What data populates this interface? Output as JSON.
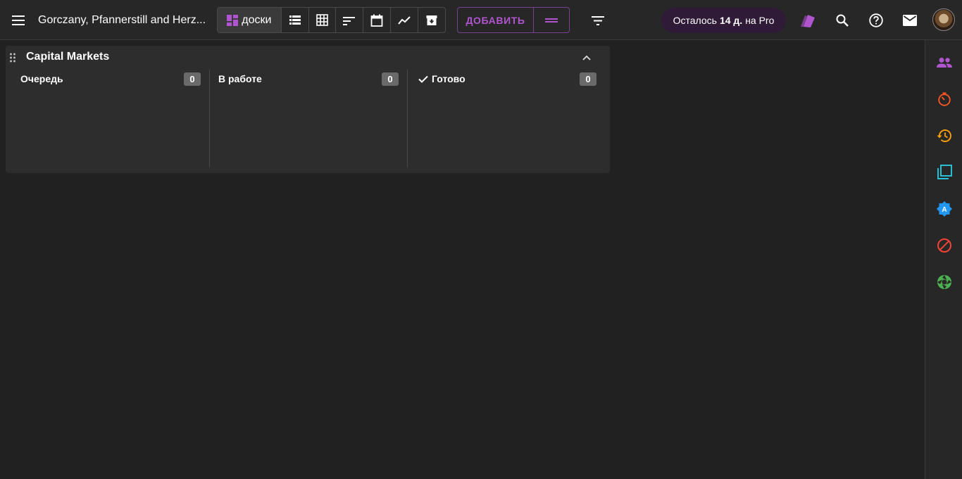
{
  "header": {
    "project_title": "Gorczany, Pfannerstill and Herz...",
    "boards_label": "доски",
    "add_label": "ДОБАВИТЬ",
    "pro": {
      "prefix": "Осталось",
      "days": "14 д.",
      "suffix": "на Pro"
    }
  },
  "board": {
    "title": "Capital Markets",
    "columns": [
      {
        "name": "Очередь",
        "count": "0"
      },
      {
        "name": "В работе",
        "count": "0"
      },
      {
        "name": "Готово",
        "count": "0"
      }
    ]
  },
  "icons": {
    "menu": "menu-icon",
    "boards": "boards-icon",
    "list": "list-icon",
    "table": "table-grid-icon",
    "gantt": "gantt-sort-icon",
    "calendar": "calendar-icon",
    "chart": "trend-chart-icon",
    "archive": "archive-icon",
    "filter": "filter-icon",
    "tags": "tags-icon",
    "search": "search-icon",
    "help": "help-icon",
    "mail": "mail-icon"
  },
  "colors": {
    "accent": "#b055cf",
    "people": "#b055cf",
    "timer": "#ff5722",
    "history": "#ffa000",
    "copy": "#26c6da",
    "badge": "#2196f3",
    "blocked": "#f44336",
    "aperture": "#4caf50"
  }
}
